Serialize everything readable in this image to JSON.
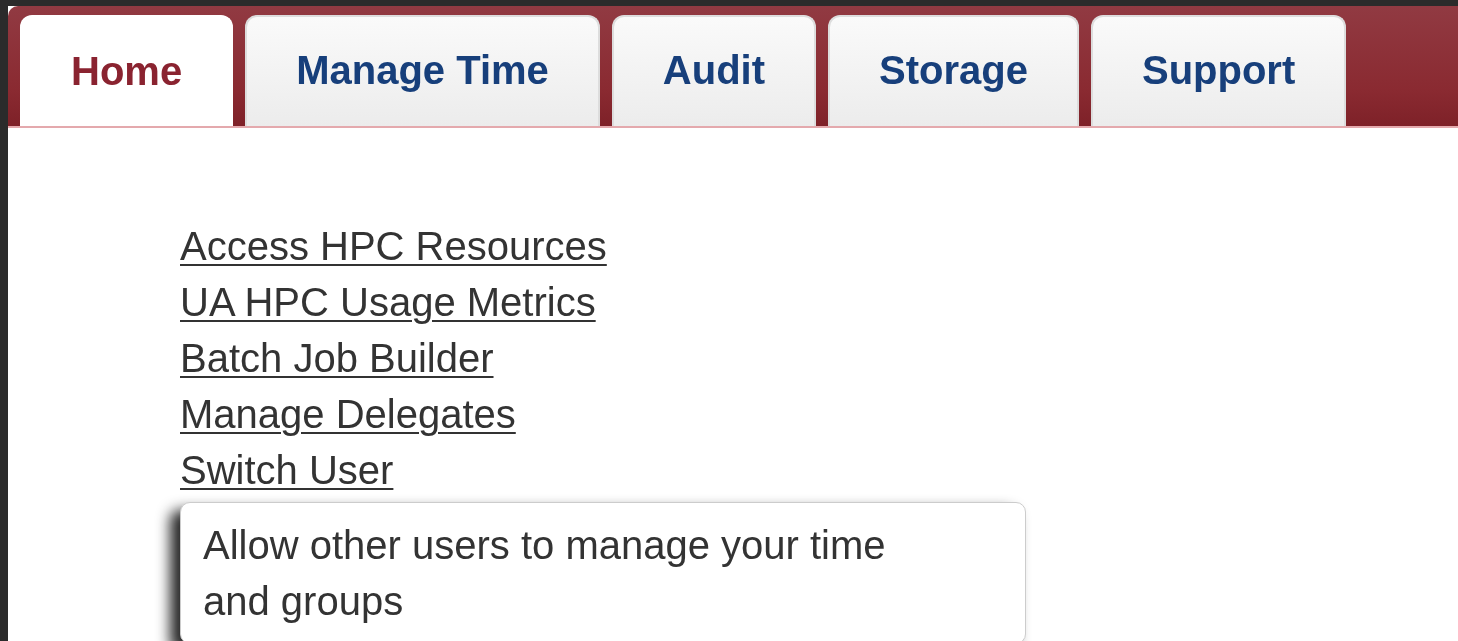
{
  "tabs": [
    {
      "label": "Home",
      "selected": true
    },
    {
      "label": "Manage Time",
      "selected": false
    },
    {
      "label": "Audit",
      "selected": false
    },
    {
      "label": "Storage",
      "selected": false
    },
    {
      "label": "Support",
      "selected": false
    }
  ],
  "links": [
    "Access HPC Resources",
    "UA HPC Usage Metrics",
    "Batch Job Builder",
    "Manage Delegates",
    "Switch User"
  ],
  "tooltip": {
    "text": "Allow other users to manage your time and groups"
  }
}
